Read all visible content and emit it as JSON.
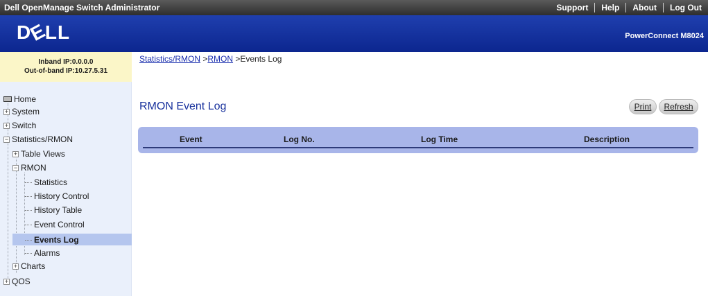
{
  "topbar": {
    "app_title": "Dell OpenManage Switch Administrator",
    "links": [
      "Support",
      "Help",
      "About",
      "Log Out"
    ]
  },
  "banner": {
    "logo_text": "D",
    "logo_e": "E",
    "logo_rest": "LL",
    "model": "PowerConnect M8024"
  },
  "ipbox": {
    "inband": "Inband IP:0.0.0.0",
    "outofband": "Out-of-band IP:10.27.5.31"
  },
  "nav": {
    "home": "Home",
    "system": "System",
    "switch": "Switch",
    "stats_rmon": "Statistics/RMON",
    "table_views": "Table Views",
    "rmon": "RMON",
    "statistics": "Statistics",
    "history_control": "History Control",
    "history_table": "History Table",
    "event_control": "Event Control",
    "events_log": "Events Log",
    "alarms": "Alarms",
    "charts": "Charts",
    "qos": "QOS"
  },
  "breadcrumb": {
    "part1": "Statistics/RMON",
    "sep1": " >",
    "part2": "RMON",
    "sep2": " >",
    "current": "Events Log"
  },
  "main": {
    "title": "RMON Event Log",
    "print_label": "Print",
    "refresh_label": "Refresh",
    "columns": [
      "Event",
      "Log No.",
      "Log Time",
      "Description"
    ]
  }
}
